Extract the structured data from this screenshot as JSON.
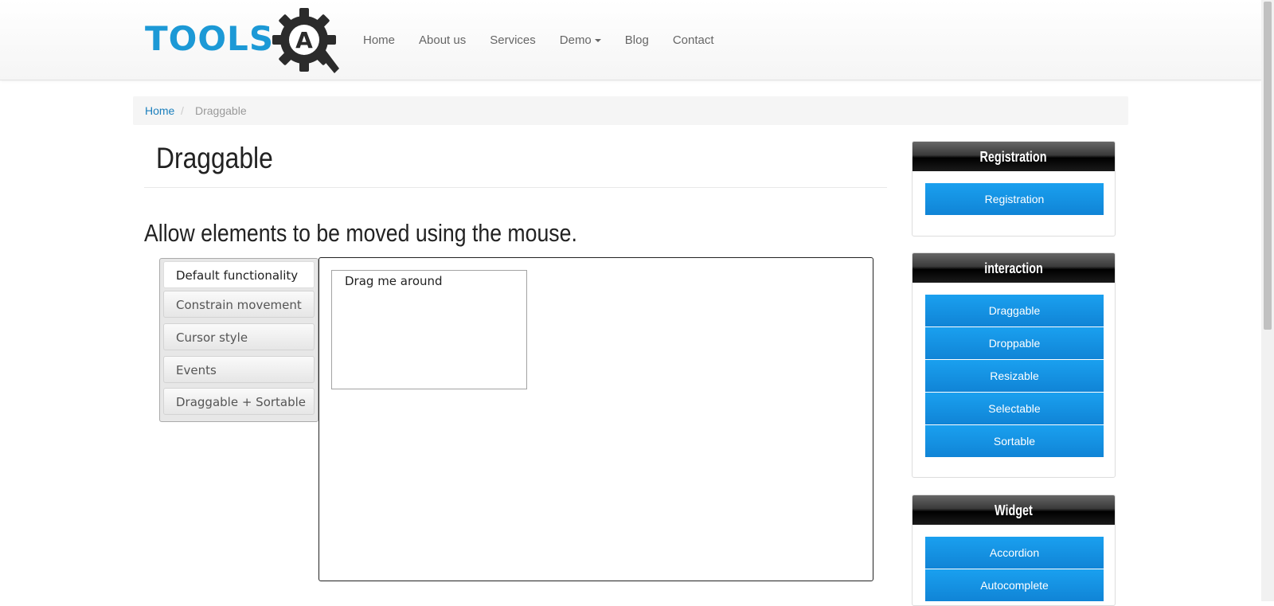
{
  "header": {
    "logo_text": "TOOLS",
    "logo_mark": "A",
    "nav": [
      {
        "label": "Home"
      },
      {
        "label": "About us"
      },
      {
        "label": "Services"
      },
      {
        "label": "Demo",
        "has_dropdown": true
      },
      {
        "label": "Blog"
      },
      {
        "label": "Contact"
      }
    ]
  },
  "breadcrumb": {
    "home": "Home",
    "separator": "/",
    "current": "Draggable"
  },
  "main": {
    "title": "Draggable",
    "subtitle": "Allow elements to be moved using the mouse.",
    "tabs": [
      {
        "label": "Default functionality",
        "active": true
      },
      {
        "label": "Constrain movement"
      },
      {
        "label": "Cursor style"
      },
      {
        "label": "Events"
      },
      {
        "label": "Draggable + Sortable"
      }
    ],
    "drag_box_label": "Drag me around"
  },
  "sidebar": {
    "widgets": [
      {
        "title": "Registration",
        "items": [
          "Registration"
        ]
      },
      {
        "title": "interaction",
        "items": [
          "Draggable",
          "Droppable",
          "Resizable",
          "Selectable",
          "Sortable"
        ]
      },
      {
        "title": "Widget",
        "items": [
          "Accordion",
          "Autocomplete"
        ]
      }
    ]
  },
  "colors": {
    "accent_blue": "#1c99d6",
    "button_blue": "#1590e2",
    "link_blue": "#1b7fbd",
    "widget_header": "#000000"
  }
}
